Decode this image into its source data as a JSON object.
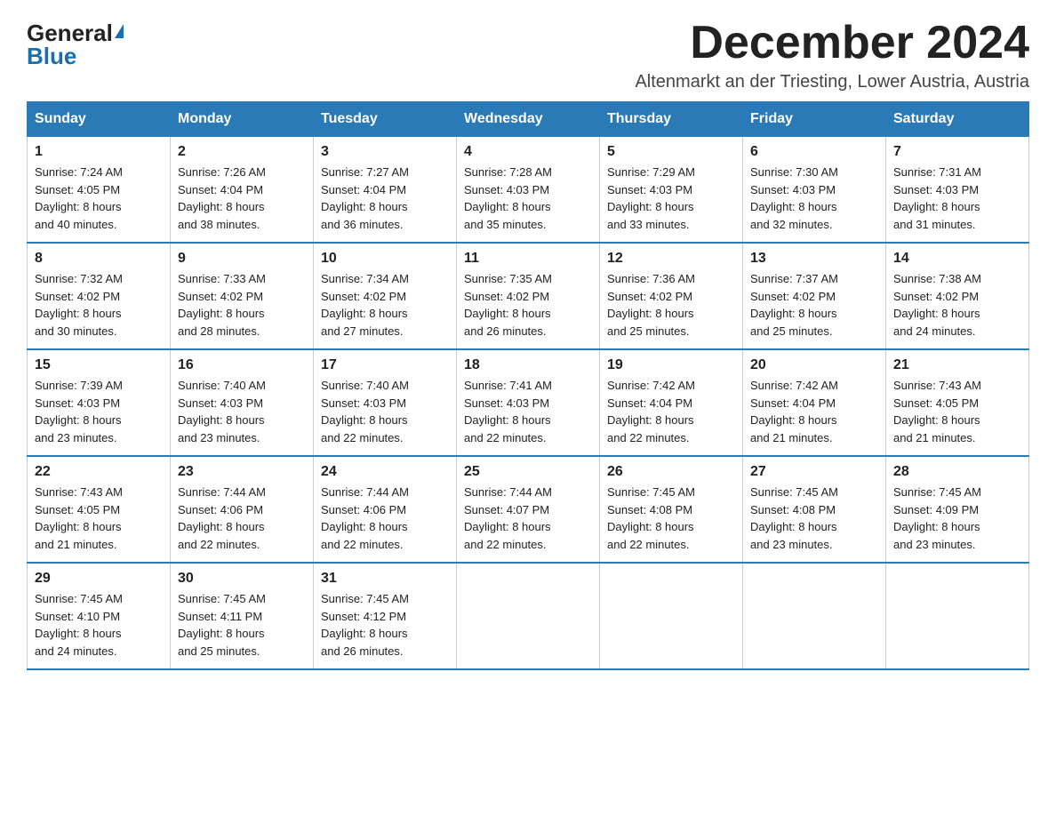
{
  "header": {
    "logo_general": "General",
    "logo_blue": "Blue",
    "month_title": "December 2024",
    "location": "Altenmarkt an der Triesting, Lower Austria, Austria"
  },
  "days_of_week": [
    "Sunday",
    "Monday",
    "Tuesday",
    "Wednesday",
    "Thursday",
    "Friday",
    "Saturday"
  ],
  "weeks": [
    [
      {
        "day": "1",
        "sunrise": "7:24 AM",
        "sunset": "4:05 PM",
        "daylight": "8 hours and 40 minutes."
      },
      {
        "day": "2",
        "sunrise": "7:26 AM",
        "sunset": "4:04 PM",
        "daylight": "8 hours and 38 minutes."
      },
      {
        "day": "3",
        "sunrise": "7:27 AM",
        "sunset": "4:04 PM",
        "daylight": "8 hours and 36 minutes."
      },
      {
        "day": "4",
        "sunrise": "7:28 AM",
        "sunset": "4:03 PM",
        "daylight": "8 hours and 35 minutes."
      },
      {
        "day": "5",
        "sunrise": "7:29 AM",
        "sunset": "4:03 PM",
        "daylight": "8 hours and 33 minutes."
      },
      {
        "day": "6",
        "sunrise": "7:30 AM",
        "sunset": "4:03 PM",
        "daylight": "8 hours and 32 minutes."
      },
      {
        "day": "7",
        "sunrise": "7:31 AM",
        "sunset": "4:03 PM",
        "daylight": "8 hours and 31 minutes."
      }
    ],
    [
      {
        "day": "8",
        "sunrise": "7:32 AM",
        "sunset": "4:02 PM",
        "daylight": "8 hours and 30 minutes."
      },
      {
        "day": "9",
        "sunrise": "7:33 AM",
        "sunset": "4:02 PM",
        "daylight": "8 hours and 28 minutes."
      },
      {
        "day": "10",
        "sunrise": "7:34 AM",
        "sunset": "4:02 PM",
        "daylight": "8 hours and 27 minutes."
      },
      {
        "day": "11",
        "sunrise": "7:35 AM",
        "sunset": "4:02 PM",
        "daylight": "8 hours and 26 minutes."
      },
      {
        "day": "12",
        "sunrise": "7:36 AM",
        "sunset": "4:02 PM",
        "daylight": "8 hours and 25 minutes."
      },
      {
        "day": "13",
        "sunrise": "7:37 AM",
        "sunset": "4:02 PM",
        "daylight": "8 hours and 25 minutes."
      },
      {
        "day": "14",
        "sunrise": "7:38 AM",
        "sunset": "4:02 PM",
        "daylight": "8 hours and 24 minutes."
      }
    ],
    [
      {
        "day": "15",
        "sunrise": "7:39 AM",
        "sunset": "4:03 PM",
        "daylight": "8 hours and 23 minutes."
      },
      {
        "day": "16",
        "sunrise": "7:40 AM",
        "sunset": "4:03 PM",
        "daylight": "8 hours and 23 minutes."
      },
      {
        "day": "17",
        "sunrise": "7:40 AM",
        "sunset": "4:03 PM",
        "daylight": "8 hours and 22 minutes."
      },
      {
        "day": "18",
        "sunrise": "7:41 AM",
        "sunset": "4:03 PM",
        "daylight": "8 hours and 22 minutes."
      },
      {
        "day": "19",
        "sunrise": "7:42 AM",
        "sunset": "4:04 PM",
        "daylight": "8 hours and 22 minutes."
      },
      {
        "day": "20",
        "sunrise": "7:42 AM",
        "sunset": "4:04 PM",
        "daylight": "8 hours and 21 minutes."
      },
      {
        "day": "21",
        "sunrise": "7:43 AM",
        "sunset": "4:05 PM",
        "daylight": "8 hours and 21 minutes."
      }
    ],
    [
      {
        "day": "22",
        "sunrise": "7:43 AM",
        "sunset": "4:05 PM",
        "daylight": "8 hours and 21 minutes."
      },
      {
        "day": "23",
        "sunrise": "7:44 AM",
        "sunset": "4:06 PM",
        "daylight": "8 hours and 22 minutes."
      },
      {
        "day": "24",
        "sunrise": "7:44 AM",
        "sunset": "4:06 PM",
        "daylight": "8 hours and 22 minutes."
      },
      {
        "day": "25",
        "sunrise": "7:44 AM",
        "sunset": "4:07 PM",
        "daylight": "8 hours and 22 minutes."
      },
      {
        "day": "26",
        "sunrise": "7:45 AM",
        "sunset": "4:08 PM",
        "daylight": "8 hours and 22 minutes."
      },
      {
        "day": "27",
        "sunrise": "7:45 AM",
        "sunset": "4:08 PM",
        "daylight": "8 hours and 23 minutes."
      },
      {
        "day": "28",
        "sunrise": "7:45 AM",
        "sunset": "4:09 PM",
        "daylight": "8 hours and 23 minutes."
      }
    ],
    [
      {
        "day": "29",
        "sunrise": "7:45 AM",
        "sunset": "4:10 PM",
        "daylight": "8 hours and 24 minutes."
      },
      {
        "day": "30",
        "sunrise": "7:45 AM",
        "sunset": "4:11 PM",
        "daylight": "8 hours and 25 minutes."
      },
      {
        "day": "31",
        "sunrise": "7:45 AM",
        "sunset": "4:12 PM",
        "daylight": "8 hours and 26 minutes."
      },
      null,
      null,
      null,
      null
    ]
  ],
  "labels": {
    "sunrise": "Sunrise:",
    "sunset": "Sunset:",
    "daylight": "Daylight:"
  }
}
